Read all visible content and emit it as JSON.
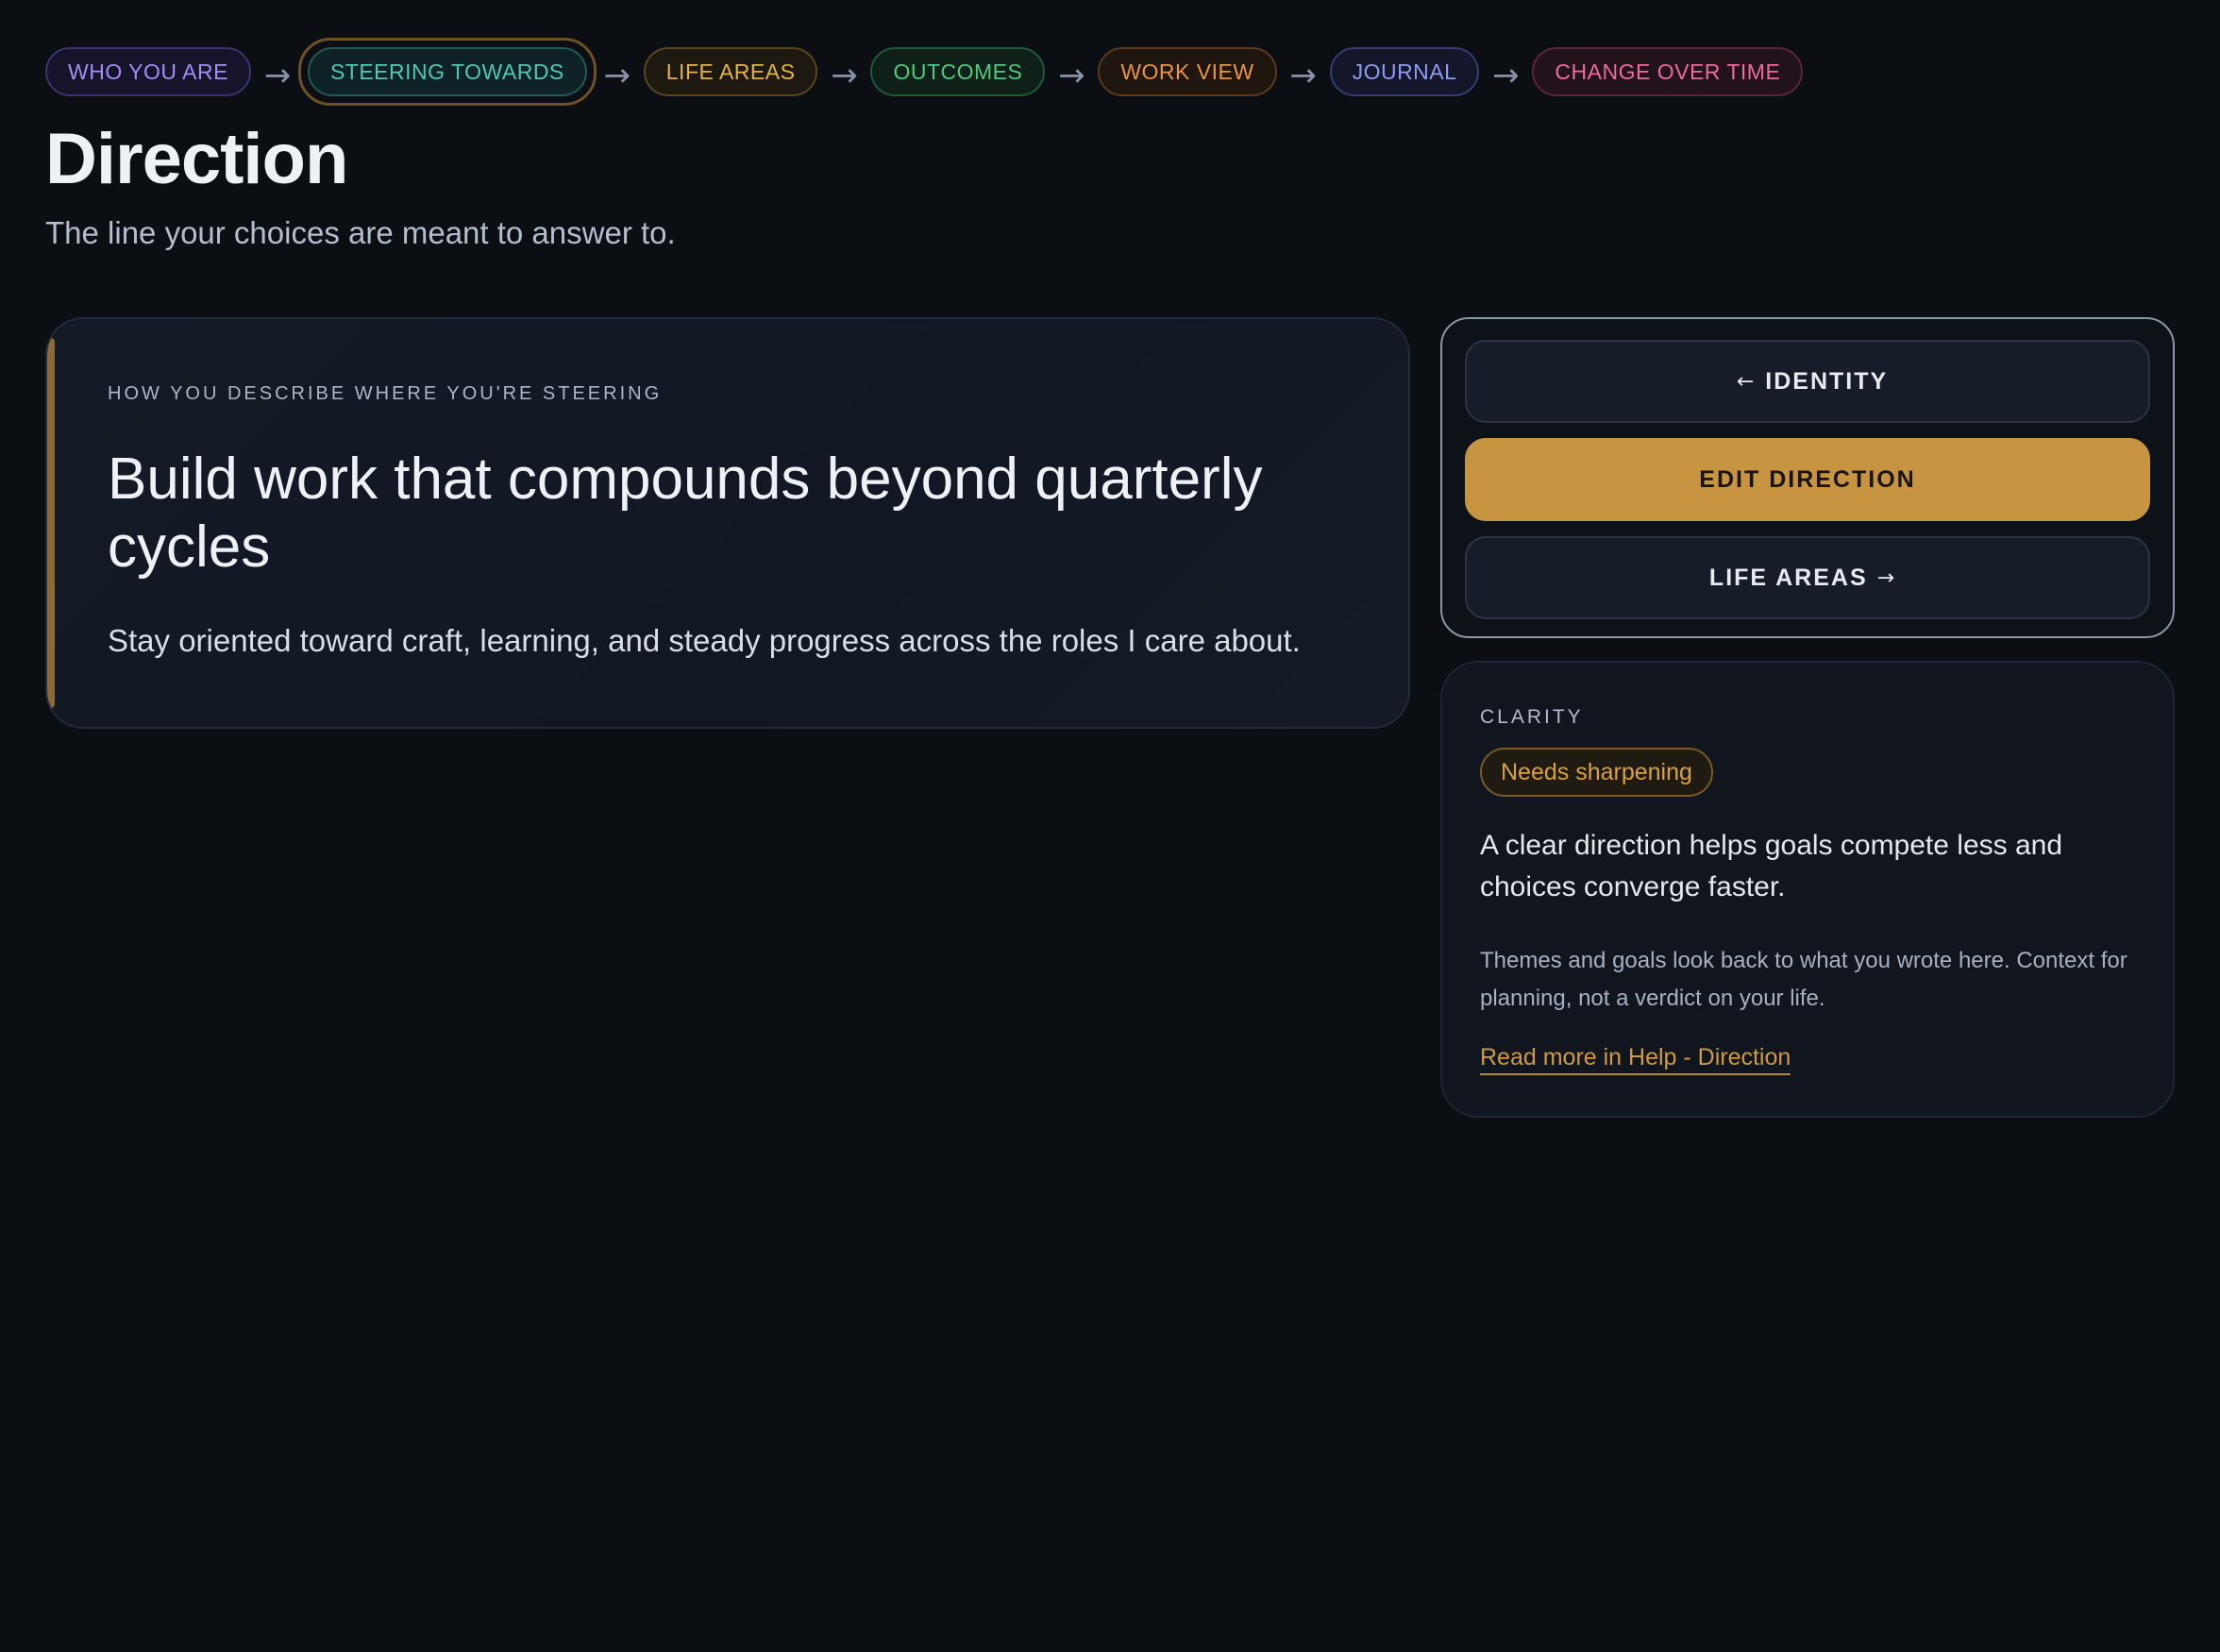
{
  "flow": {
    "steps": [
      {
        "label": "WHO YOU ARE",
        "color": "#a68cf5",
        "border": "#3c3470",
        "bg": "#16142a"
      },
      {
        "label": "STEERING TOWARDS",
        "color": "#4fc9b4",
        "border": "#1f5a55",
        "bg": "#0f2226",
        "active": true
      },
      {
        "label": "LIFE AREAS",
        "color": "#e7b341",
        "border": "#5a4620",
        "bg": "#1d1810"
      },
      {
        "label": "OUTCOMES",
        "color": "#4fc97e",
        "border": "#1f5a38",
        "bg": "#0f2018"
      },
      {
        "label": "WORK VIEW",
        "color": "#eb9444",
        "border": "#5c3a1e",
        "bg": "#1f1610"
      },
      {
        "label": "JOURNAL",
        "color": "#8f9bf2",
        "border": "#363d70",
        "bg": "#14172a"
      },
      {
        "label": "CHANGE OVER TIME",
        "color": "#ee6aa0",
        "border": "#5c2440",
        "bg": "#22121b"
      }
    ],
    "arrow": "→"
  },
  "header": {
    "title": "Direction",
    "subtitle": "The line your choices are meant to answer to."
  },
  "statement": {
    "eyebrow": "HOW YOU DESCRIBE WHERE YOU'RE STEERING",
    "heading": "Build work that compounds beyond quarterly cycles",
    "body": "Stay oriented toward craft, learning, and steady progress across the roles I care about."
  },
  "nav": {
    "back_label": "IDENTITY",
    "back_icon": "←",
    "edit_label": "EDIT DIRECTION",
    "next_label": "LIFE AREAS",
    "next_icon": "→"
  },
  "clarity": {
    "eyebrow": "CLARITY",
    "badge": "Needs sharpening",
    "main": "A clear direction helps goals compete less and choices converge faster.",
    "note": "Themes and goals look back to what you wrote here. Context for planning, not a verdict on your life.",
    "link": "Read more in Help - Direction"
  },
  "colors": {
    "accent": "#c79441",
    "background": "#0b0e13"
  }
}
